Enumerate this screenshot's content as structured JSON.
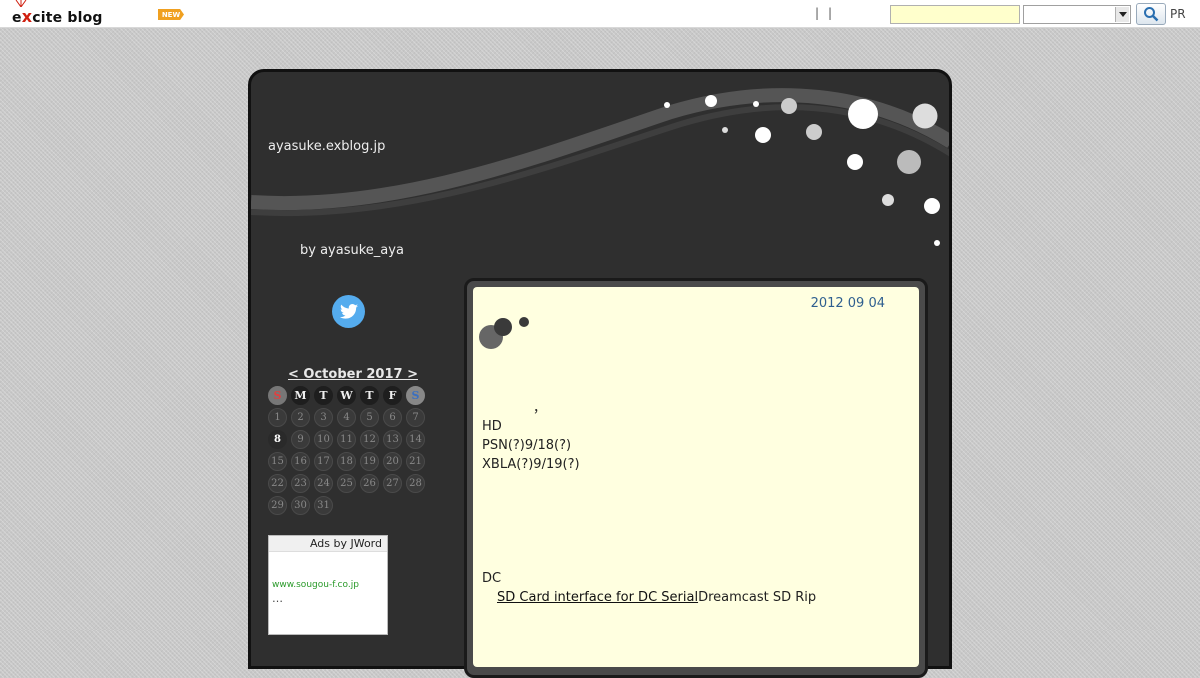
{
  "topbar": {
    "logo_prefix": "e",
    "logo_x": "x",
    "logo_suffix": "cite blog",
    "new_badge": "NEW",
    "separators": [
      "|",
      "|"
    ],
    "search_placeholder": "",
    "search_select_value": "",
    "pr_label": "PR"
  },
  "blog": {
    "title": "ayasuke.exblog.jp",
    "byline": "by ayasuke_aya"
  },
  "calendar": {
    "title": "< October 2017 >",
    "weekdays": [
      "S",
      "M",
      "T",
      "W",
      "T",
      "F",
      "S"
    ],
    "days": [
      "1",
      "2",
      "3",
      "4",
      "5",
      "6",
      "7",
      "8",
      "9",
      "10",
      "11",
      "12",
      "13",
      "14",
      "15",
      "16",
      "17",
      "18",
      "19",
      "20",
      "21",
      "22",
      "23",
      "24",
      "25",
      "26",
      "27",
      "28",
      "29",
      "30",
      "31"
    ],
    "today": "8"
  },
  "ad": {
    "header": "Ads by JWord",
    "url": "www.sougou-f.co.jp",
    "more": "…"
  },
  "entry": {
    "date": "2012 09 04",
    "comma": "，",
    "lines": [
      "HD",
      "PSN(?)9/18(?)",
      "XBLA(?)9/19(?)"
    ],
    "dc_label": "DC",
    "link_text": "SD Card interface for DC Serial",
    "link_suffix": "Dreamcast SD Rip"
  },
  "colors": {
    "frame_bg": "#2f2f2f",
    "entry_bg": "#ffffe0",
    "date_color": "#2f5f8f",
    "twitter_blue": "#55acee",
    "search_bg": "#ffffcc"
  }
}
